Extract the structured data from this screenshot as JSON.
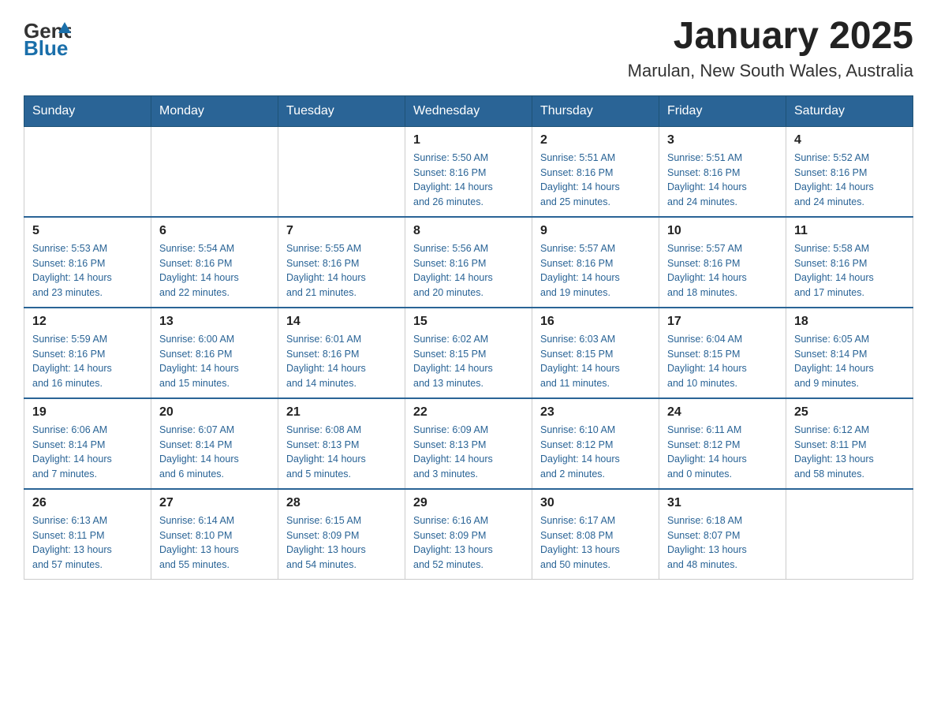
{
  "header": {
    "logo": {
      "general": "General",
      "blue": "Blue"
    },
    "title": "January 2025",
    "location": "Marulan, New South Wales, Australia"
  },
  "days_of_week": [
    "Sunday",
    "Monday",
    "Tuesday",
    "Wednesday",
    "Thursday",
    "Friday",
    "Saturday"
  ],
  "weeks": [
    [
      {
        "day": "",
        "info": ""
      },
      {
        "day": "",
        "info": ""
      },
      {
        "day": "",
        "info": ""
      },
      {
        "day": "1",
        "info": "Sunrise: 5:50 AM\nSunset: 8:16 PM\nDaylight: 14 hours\nand 26 minutes."
      },
      {
        "day": "2",
        "info": "Sunrise: 5:51 AM\nSunset: 8:16 PM\nDaylight: 14 hours\nand 25 minutes."
      },
      {
        "day": "3",
        "info": "Sunrise: 5:51 AM\nSunset: 8:16 PM\nDaylight: 14 hours\nand 24 minutes."
      },
      {
        "day": "4",
        "info": "Sunrise: 5:52 AM\nSunset: 8:16 PM\nDaylight: 14 hours\nand 24 minutes."
      }
    ],
    [
      {
        "day": "5",
        "info": "Sunrise: 5:53 AM\nSunset: 8:16 PM\nDaylight: 14 hours\nand 23 minutes."
      },
      {
        "day": "6",
        "info": "Sunrise: 5:54 AM\nSunset: 8:16 PM\nDaylight: 14 hours\nand 22 minutes."
      },
      {
        "day": "7",
        "info": "Sunrise: 5:55 AM\nSunset: 8:16 PM\nDaylight: 14 hours\nand 21 minutes."
      },
      {
        "day": "8",
        "info": "Sunrise: 5:56 AM\nSunset: 8:16 PM\nDaylight: 14 hours\nand 20 minutes."
      },
      {
        "day": "9",
        "info": "Sunrise: 5:57 AM\nSunset: 8:16 PM\nDaylight: 14 hours\nand 19 minutes."
      },
      {
        "day": "10",
        "info": "Sunrise: 5:57 AM\nSunset: 8:16 PM\nDaylight: 14 hours\nand 18 minutes."
      },
      {
        "day": "11",
        "info": "Sunrise: 5:58 AM\nSunset: 8:16 PM\nDaylight: 14 hours\nand 17 minutes."
      }
    ],
    [
      {
        "day": "12",
        "info": "Sunrise: 5:59 AM\nSunset: 8:16 PM\nDaylight: 14 hours\nand 16 minutes."
      },
      {
        "day": "13",
        "info": "Sunrise: 6:00 AM\nSunset: 8:16 PM\nDaylight: 14 hours\nand 15 minutes."
      },
      {
        "day": "14",
        "info": "Sunrise: 6:01 AM\nSunset: 8:16 PM\nDaylight: 14 hours\nand 14 minutes."
      },
      {
        "day": "15",
        "info": "Sunrise: 6:02 AM\nSunset: 8:15 PM\nDaylight: 14 hours\nand 13 minutes."
      },
      {
        "day": "16",
        "info": "Sunrise: 6:03 AM\nSunset: 8:15 PM\nDaylight: 14 hours\nand 11 minutes."
      },
      {
        "day": "17",
        "info": "Sunrise: 6:04 AM\nSunset: 8:15 PM\nDaylight: 14 hours\nand 10 minutes."
      },
      {
        "day": "18",
        "info": "Sunrise: 6:05 AM\nSunset: 8:14 PM\nDaylight: 14 hours\nand 9 minutes."
      }
    ],
    [
      {
        "day": "19",
        "info": "Sunrise: 6:06 AM\nSunset: 8:14 PM\nDaylight: 14 hours\nand 7 minutes."
      },
      {
        "day": "20",
        "info": "Sunrise: 6:07 AM\nSunset: 8:14 PM\nDaylight: 14 hours\nand 6 minutes."
      },
      {
        "day": "21",
        "info": "Sunrise: 6:08 AM\nSunset: 8:13 PM\nDaylight: 14 hours\nand 5 minutes."
      },
      {
        "day": "22",
        "info": "Sunrise: 6:09 AM\nSunset: 8:13 PM\nDaylight: 14 hours\nand 3 minutes."
      },
      {
        "day": "23",
        "info": "Sunrise: 6:10 AM\nSunset: 8:12 PM\nDaylight: 14 hours\nand 2 minutes."
      },
      {
        "day": "24",
        "info": "Sunrise: 6:11 AM\nSunset: 8:12 PM\nDaylight: 14 hours\nand 0 minutes."
      },
      {
        "day": "25",
        "info": "Sunrise: 6:12 AM\nSunset: 8:11 PM\nDaylight: 13 hours\nand 58 minutes."
      }
    ],
    [
      {
        "day": "26",
        "info": "Sunrise: 6:13 AM\nSunset: 8:11 PM\nDaylight: 13 hours\nand 57 minutes."
      },
      {
        "day": "27",
        "info": "Sunrise: 6:14 AM\nSunset: 8:10 PM\nDaylight: 13 hours\nand 55 minutes."
      },
      {
        "day": "28",
        "info": "Sunrise: 6:15 AM\nSunset: 8:09 PM\nDaylight: 13 hours\nand 54 minutes."
      },
      {
        "day": "29",
        "info": "Sunrise: 6:16 AM\nSunset: 8:09 PM\nDaylight: 13 hours\nand 52 minutes."
      },
      {
        "day": "30",
        "info": "Sunrise: 6:17 AM\nSunset: 8:08 PM\nDaylight: 13 hours\nand 50 minutes."
      },
      {
        "day": "31",
        "info": "Sunrise: 6:18 AM\nSunset: 8:07 PM\nDaylight: 13 hours\nand 48 minutes."
      },
      {
        "day": "",
        "info": ""
      }
    ]
  ]
}
